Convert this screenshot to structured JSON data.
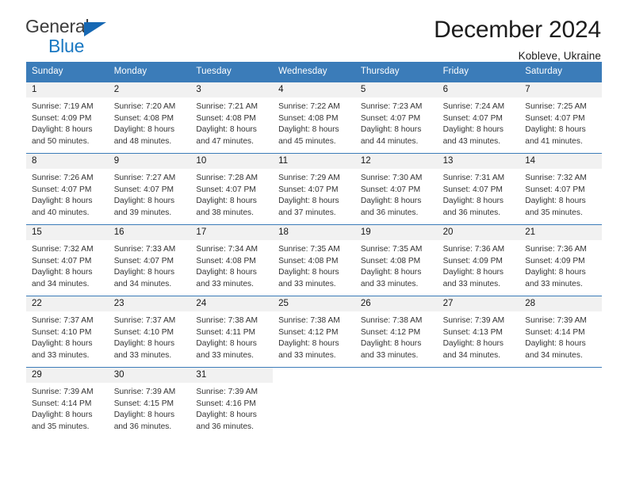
{
  "brand": {
    "name_part1": "General",
    "name_part2": "Blue",
    "triangle_color": "#1668b3"
  },
  "header": {
    "title": "December 2024",
    "subtitle": "Kobleve, Ukraine"
  },
  "theme": {
    "header_blue": "#3b7cb9",
    "daynum_band": "#f1f1f1",
    "text": "#333333"
  },
  "weekday_headers": [
    "Sunday",
    "Monday",
    "Tuesday",
    "Wednesday",
    "Thursday",
    "Friday",
    "Saturday"
  ],
  "weeks": [
    [
      {
        "day": "1",
        "sunrise": "Sunrise: 7:19 AM",
        "sunset": "Sunset: 4:09 PM",
        "daylight1": "Daylight: 8 hours",
        "daylight2": "and 50 minutes."
      },
      {
        "day": "2",
        "sunrise": "Sunrise: 7:20 AM",
        "sunset": "Sunset: 4:08 PM",
        "daylight1": "Daylight: 8 hours",
        "daylight2": "and 48 minutes."
      },
      {
        "day": "3",
        "sunrise": "Sunrise: 7:21 AM",
        "sunset": "Sunset: 4:08 PM",
        "daylight1": "Daylight: 8 hours",
        "daylight2": "and 47 minutes."
      },
      {
        "day": "4",
        "sunrise": "Sunrise: 7:22 AM",
        "sunset": "Sunset: 4:08 PM",
        "daylight1": "Daylight: 8 hours",
        "daylight2": "and 45 minutes."
      },
      {
        "day": "5",
        "sunrise": "Sunrise: 7:23 AM",
        "sunset": "Sunset: 4:07 PM",
        "daylight1": "Daylight: 8 hours",
        "daylight2": "and 44 minutes."
      },
      {
        "day": "6",
        "sunrise": "Sunrise: 7:24 AM",
        "sunset": "Sunset: 4:07 PM",
        "daylight1": "Daylight: 8 hours",
        "daylight2": "and 43 minutes."
      },
      {
        "day": "7",
        "sunrise": "Sunrise: 7:25 AM",
        "sunset": "Sunset: 4:07 PM",
        "daylight1": "Daylight: 8 hours",
        "daylight2": "and 41 minutes."
      }
    ],
    [
      {
        "day": "8",
        "sunrise": "Sunrise: 7:26 AM",
        "sunset": "Sunset: 4:07 PM",
        "daylight1": "Daylight: 8 hours",
        "daylight2": "and 40 minutes."
      },
      {
        "day": "9",
        "sunrise": "Sunrise: 7:27 AM",
        "sunset": "Sunset: 4:07 PM",
        "daylight1": "Daylight: 8 hours",
        "daylight2": "and 39 minutes."
      },
      {
        "day": "10",
        "sunrise": "Sunrise: 7:28 AM",
        "sunset": "Sunset: 4:07 PM",
        "daylight1": "Daylight: 8 hours",
        "daylight2": "and 38 minutes."
      },
      {
        "day": "11",
        "sunrise": "Sunrise: 7:29 AM",
        "sunset": "Sunset: 4:07 PM",
        "daylight1": "Daylight: 8 hours",
        "daylight2": "and 37 minutes."
      },
      {
        "day": "12",
        "sunrise": "Sunrise: 7:30 AM",
        "sunset": "Sunset: 4:07 PM",
        "daylight1": "Daylight: 8 hours",
        "daylight2": "and 36 minutes."
      },
      {
        "day": "13",
        "sunrise": "Sunrise: 7:31 AM",
        "sunset": "Sunset: 4:07 PM",
        "daylight1": "Daylight: 8 hours",
        "daylight2": "and 36 minutes."
      },
      {
        "day": "14",
        "sunrise": "Sunrise: 7:32 AM",
        "sunset": "Sunset: 4:07 PM",
        "daylight1": "Daylight: 8 hours",
        "daylight2": "and 35 minutes."
      }
    ],
    [
      {
        "day": "15",
        "sunrise": "Sunrise: 7:32 AM",
        "sunset": "Sunset: 4:07 PM",
        "daylight1": "Daylight: 8 hours",
        "daylight2": "and 34 minutes."
      },
      {
        "day": "16",
        "sunrise": "Sunrise: 7:33 AM",
        "sunset": "Sunset: 4:07 PM",
        "daylight1": "Daylight: 8 hours",
        "daylight2": "and 34 minutes."
      },
      {
        "day": "17",
        "sunrise": "Sunrise: 7:34 AM",
        "sunset": "Sunset: 4:08 PM",
        "daylight1": "Daylight: 8 hours",
        "daylight2": "and 33 minutes."
      },
      {
        "day": "18",
        "sunrise": "Sunrise: 7:35 AM",
        "sunset": "Sunset: 4:08 PM",
        "daylight1": "Daylight: 8 hours",
        "daylight2": "and 33 minutes."
      },
      {
        "day": "19",
        "sunrise": "Sunrise: 7:35 AM",
        "sunset": "Sunset: 4:08 PM",
        "daylight1": "Daylight: 8 hours",
        "daylight2": "and 33 minutes."
      },
      {
        "day": "20",
        "sunrise": "Sunrise: 7:36 AM",
        "sunset": "Sunset: 4:09 PM",
        "daylight1": "Daylight: 8 hours",
        "daylight2": "and 33 minutes."
      },
      {
        "day": "21",
        "sunrise": "Sunrise: 7:36 AM",
        "sunset": "Sunset: 4:09 PM",
        "daylight1": "Daylight: 8 hours",
        "daylight2": "and 33 minutes."
      }
    ],
    [
      {
        "day": "22",
        "sunrise": "Sunrise: 7:37 AM",
        "sunset": "Sunset: 4:10 PM",
        "daylight1": "Daylight: 8 hours",
        "daylight2": "and 33 minutes."
      },
      {
        "day": "23",
        "sunrise": "Sunrise: 7:37 AM",
        "sunset": "Sunset: 4:10 PM",
        "daylight1": "Daylight: 8 hours",
        "daylight2": "and 33 minutes."
      },
      {
        "day": "24",
        "sunrise": "Sunrise: 7:38 AM",
        "sunset": "Sunset: 4:11 PM",
        "daylight1": "Daylight: 8 hours",
        "daylight2": "and 33 minutes."
      },
      {
        "day": "25",
        "sunrise": "Sunrise: 7:38 AM",
        "sunset": "Sunset: 4:12 PM",
        "daylight1": "Daylight: 8 hours",
        "daylight2": "and 33 minutes."
      },
      {
        "day": "26",
        "sunrise": "Sunrise: 7:38 AM",
        "sunset": "Sunset: 4:12 PM",
        "daylight1": "Daylight: 8 hours",
        "daylight2": "and 33 minutes."
      },
      {
        "day": "27",
        "sunrise": "Sunrise: 7:39 AM",
        "sunset": "Sunset: 4:13 PM",
        "daylight1": "Daylight: 8 hours",
        "daylight2": "and 34 minutes."
      },
      {
        "day": "28",
        "sunrise": "Sunrise: 7:39 AM",
        "sunset": "Sunset: 4:14 PM",
        "daylight1": "Daylight: 8 hours",
        "daylight2": "and 34 minutes."
      }
    ],
    [
      {
        "day": "29",
        "sunrise": "Sunrise: 7:39 AM",
        "sunset": "Sunset: 4:14 PM",
        "daylight1": "Daylight: 8 hours",
        "daylight2": "and 35 minutes."
      },
      {
        "day": "30",
        "sunrise": "Sunrise: 7:39 AM",
        "sunset": "Sunset: 4:15 PM",
        "daylight1": "Daylight: 8 hours",
        "daylight2": "and 36 minutes."
      },
      {
        "day": "31",
        "sunrise": "Sunrise: 7:39 AM",
        "sunset": "Sunset: 4:16 PM",
        "daylight1": "Daylight: 8 hours",
        "daylight2": "and 36 minutes."
      },
      {
        "day": "",
        "sunrise": "",
        "sunset": "",
        "daylight1": "",
        "daylight2": ""
      },
      {
        "day": "",
        "sunrise": "",
        "sunset": "",
        "daylight1": "",
        "daylight2": ""
      },
      {
        "day": "",
        "sunrise": "",
        "sunset": "",
        "daylight1": "",
        "daylight2": ""
      },
      {
        "day": "",
        "sunrise": "",
        "sunset": "",
        "daylight1": "",
        "daylight2": ""
      }
    ]
  ]
}
